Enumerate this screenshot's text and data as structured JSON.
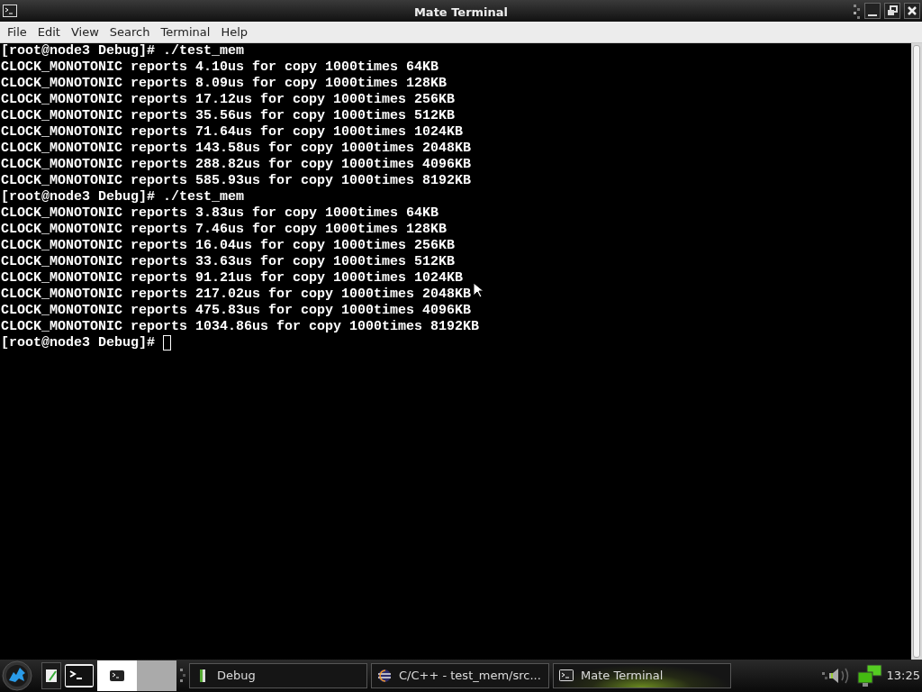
{
  "window": {
    "title": "Mate Terminal"
  },
  "menu": [
    "File",
    "Edit",
    "View",
    "Search",
    "Terminal",
    "Help"
  ],
  "terminal": {
    "lines": [
      "[root@node3 Debug]# ./test_mem",
      "CLOCK_MONOTONIC reports 4.10us for copy 1000times 64KB",
      "CLOCK_MONOTONIC reports 8.09us for copy 1000times 128KB",
      "CLOCK_MONOTONIC reports 17.12us for copy 1000times 256KB",
      "CLOCK_MONOTONIC reports 35.56us for copy 1000times 512KB",
      "CLOCK_MONOTONIC reports 71.64us for copy 1000times 1024KB",
      "CLOCK_MONOTONIC reports 143.58us for copy 1000times 2048KB",
      "CLOCK_MONOTONIC reports 288.82us for copy 1000times 4096KB",
      "CLOCK_MONOTONIC reports 585.93us for copy 1000times 8192KB",
      "[root@node3 Debug]# ./test_mem",
      "CLOCK_MONOTONIC reports 3.83us for copy 1000times 64KB",
      "CLOCK_MONOTONIC reports 7.46us for copy 1000times 128KB",
      "CLOCK_MONOTONIC reports 16.04us for copy 1000times 256KB",
      "CLOCK_MONOTONIC reports 33.63us for copy 1000times 512KB",
      "CLOCK_MONOTONIC reports 91.21us for copy 1000times 1024KB",
      "CLOCK_MONOTONIC reports 217.02us for copy 1000times 2048KB",
      "CLOCK_MONOTONIC reports 475.83us for copy 1000times 4096KB",
      "CLOCK_MONOTONIC reports 1034.86us for copy 1000times 8192KB"
    ],
    "prompt": "[root@node3 Debug]# "
  },
  "taskbar": {
    "workspaces": [
      {
        "selected": true
      },
      {
        "selected": false
      }
    ],
    "tasks": [
      {
        "label": "Debug",
        "kind": "folder",
        "selected": false
      },
      {
        "label": "C/C++ - test_mem/src...",
        "kind": "ide",
        "selected": false
      },
      {
        "label": "Mate Terminal",
        "kind": "terminal",
        "selected": true
      }
    ],
    "clock": "13:25"
  }
}
